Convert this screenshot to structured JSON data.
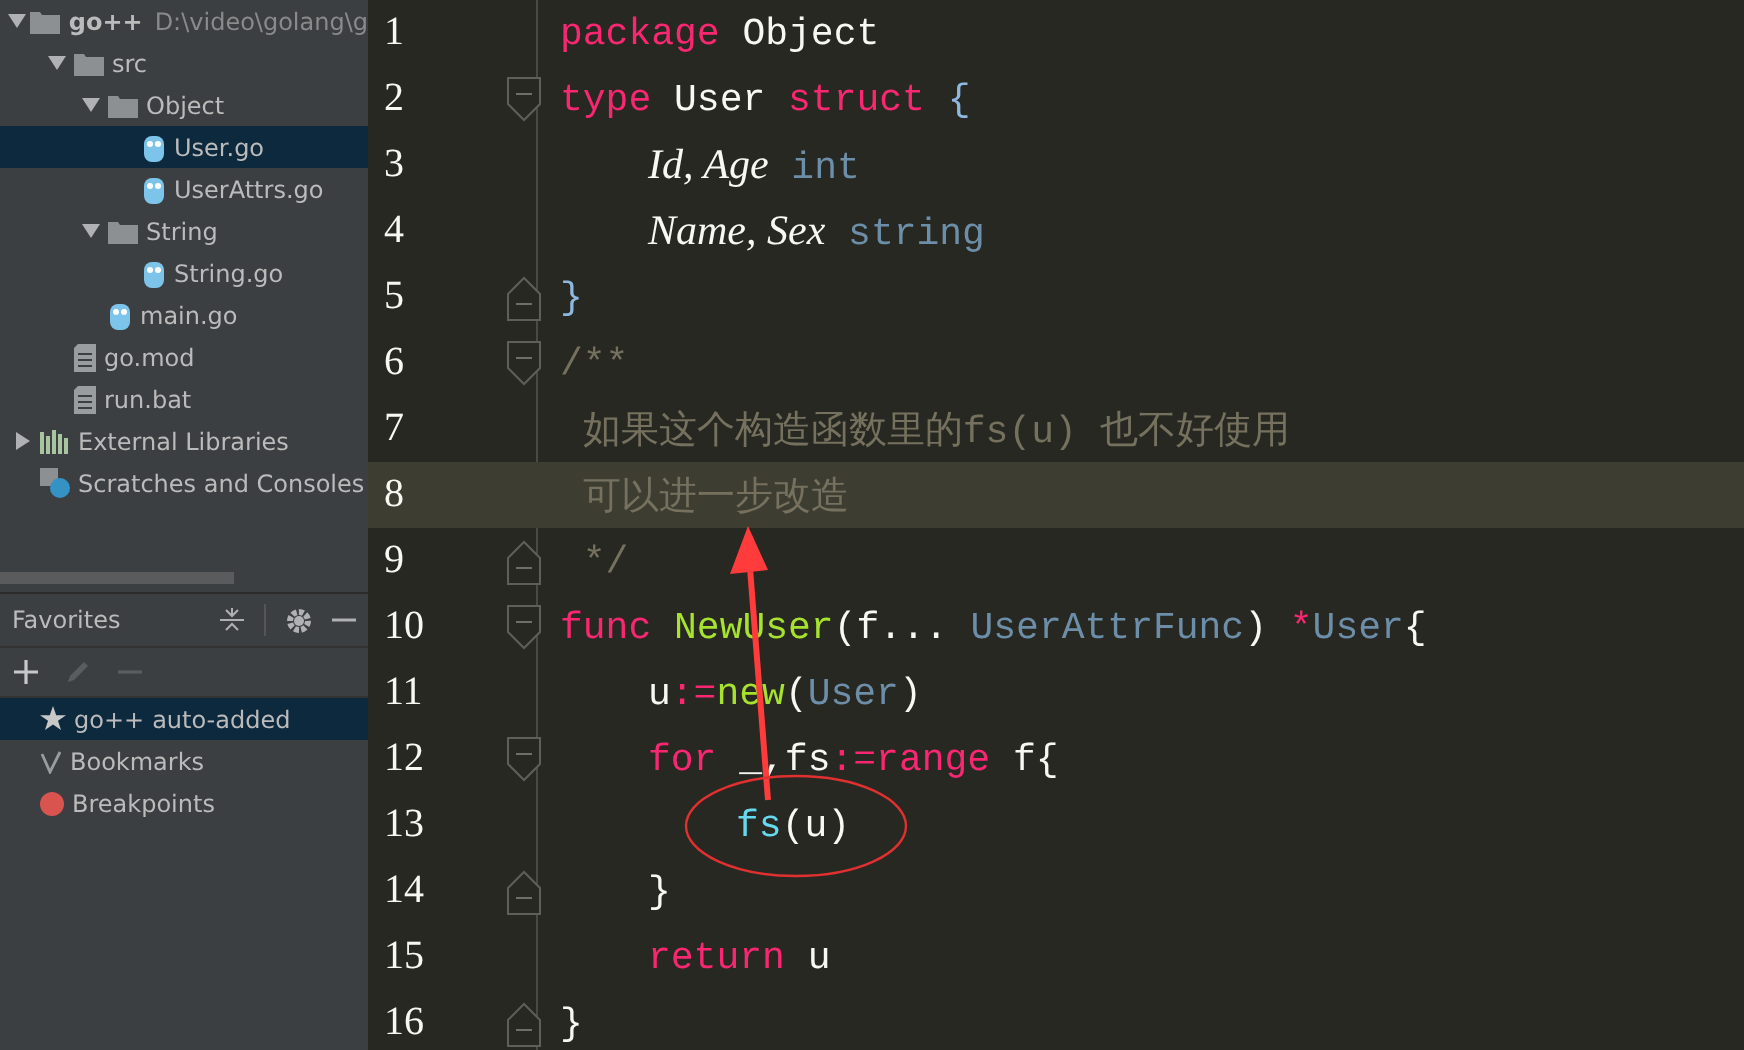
{
  "project_tree": [
    {
      "kind": "folder",
      "name": "go++",
      "path": "D:\\video\\golang\\g",
      "expanded": true,
      "selected": false,
      "children": [
        {
          "kind": "folder",
          "name": "src",
          "expanded": true,
          "selected": false,
          "children": [
            {
              "kind": "folder",
              "name": "Object",
              "expanded": true,
              "selected": false,
              "children": [
                {
                  "kind": "gofile",
                  "name": "User.go",
                  "selected": true
                },
                {
                  "kind": "gofile",
                  "name": "UserAttrs.go",
                  "selected": false
                }
              ]
            },
            {
              "kind": "folder",
              "name": "String",
              "expanded": true,
              "selected": false,
              "children": [
                {
                  "kind": "gofile",
                  "name": "String.go",
                  "selected": false
                }
              ]
            },
            {
              "kind": "gofile",
              "name": "main.go",
              "selected": false
            }
          ]
        },
        {
          "kind": "file",
          "name": "go.mod",
          "selected": false
        },
        {
          "kind": "file",
          "name": "run.bat",
          "selected": false
        }
      ]
    },
    {
      "kind": "library",
      "name": "External Libraries",
      "expanded": false,
      "selected": false
    },
    {
      "kind": "scratches",
      "name": "Scratches and Consoles",
      "selected": false
    }
  ],
  "favorites": {
    "title": "Favorites",
    "toolbar": [
      {
        "kind": "add",
        "disabled": false
      },
      {
        "kind": "edit",
        "disabled": true
      },
      {
        "kind": "remove",
        "disabled": true
      }
    ],
    "items": [
      {
        "kind": "star",
        "label": "go++",
        "note": "auto-added",
        "selected": true
      },
      {
        "kind": "check",
        "label": "Bookmarks",
        "selected": false
      },
      {
        "kind": "dot",
        "label": "Breakpoints",
        "color": "#d9534f",
        "selected": false
      }
    ]
  },
  "editor": {
    "lines": [
      {
        "number": "1",
        "fold_start": false,
        "fold_end": false,
        "current": false,
        "tokens": [
          {
            "kind": "keyword",
            "text": "package"
          },
          {
            "kind": "plain",
            "text": " Object"
          }
        ]
      },
      {
        "number": "2",
        "fold_start": true,
        "fold_end": false,
        "current": false,
        "tokens": [
          {
            "kind": "keyword",
            "text": "type"
          },
          {
            "kind": "plain",
            "text": " User "
          },
          {
            "kind": "keyword",
            "text": "struct"
          },
          {
            "kind": "brace",
            "text": " {"
          }
        ],
        "children": [
          {
            "number": "3",
            "fold_start": false,
            "fold_end": false,
            "current": false,
            "tokens": [
              {
                "kind": "field",
                "text": "Id, Age"
              },
              {
                "kind": "type",
                "text": " int"
              }
            ]
          },
          {
            "number": "4",
            "fold_start": false,
            "fold_end": false,
            "current": false,
            "tokens": [
              {
                "kind": "field",
                "text": "Name, Sex"
              },
              {
                "kind": "type",
                "text": " string"
              }
            ]
          }
        ]
      },
      {
        "number": "5",
        "fold_start": false,
        "fold_end": true,
        "current": false,
        "tokens": [
          {
            "kind": "brace",
            "text": "}"
          }
        ]
      },
      {
        "number": "6",
        "fold_start": true,
        "fold_end": false,
        "current": false,
        "tokens": [
          {
            "kind": "comment",
            "text": "/**"
          }
        ]
      },
      {
        "number": "7",
        "fold_start": false,
        "fold_end": false,
        "current": false,
        "tokens": [
          {
            "kind": "comment",
            "text": " 如果这个构造函数里的fs(u) 也不好使用"
          }
        ]
      },
      {
        "number": "8",
        "fold_start": false,
        "fold_end": false,
        "current": true,
        "tokens": [
          {
            "kind": "comment",
            "text": " 可以进一步改造"
          }
        ]
      },
      {
        "number": "9",
        "fold_start": false,
        "fold_end": true,
        "current": false,
        "tokens": [
          {
            "kind": "comment",
            "text": " */"
          }
        ]
      },
      {
        "number": "10",
        "fold_start": true,
        "fold_end": false,
        "current": false,
        "tokens": [
          {
            "kind": "keyword",
            "text": "func"
          },
          {
            "kind": "func",
            "text": " NewUser"
          },
          {
            "kind": "plain",
            "text": "(f... "
          },
          {
            "kind": "type",
            "text": "UserAttrFunc"
          },
          {
            "kind": "plain",
            "text": ") "
          },
          {
            "kind": "op",
            "text": "*"
          },
          {
            "kind": "type",
            "text": "User"
          },
          {
            "kind": "plain",
            "text": "{"
          }
        ],
        "children": [
          {
            "number": "11",
            "fold_start": false,
            "fold_end": false,
            "current": false,
            "tokens": [
              {
                "kind": "plain",
                "text": "u"
              },
              {
                "kind": "op",
                "text": ":="
              },
              {
                "kind": "func",
                "text": "new"
              },
              {
                "kind": "plain",
                "text": "("
              },
              {
                "kind": "type",
                "text": "User"
              },
              {
                "kind": "plain",
                "text": ")"
              }
            ]
          },
          {
            "number": "12",
            "fold_start": true,
            "fold_end": false,
            "current": false,
            "tokens": [
              {
                "kind": "keyword",
                "text": "for"
              },
              {
                "kind": "plain",
                "text": " _,fs"
              },
              {
                "kind": "op",
                "text": ":="
              },
              {
                "kind": "keyword",
                "text": "range"
              },
              {
                "kind": "plain",
                "text": " f{"
              }
            ],
            "children": [
              {
                "number": "13",
                "fold_start": false,
                "fold_end": false,
                "current": false,
                "tokens": [
                  {
                    "kind": "call",
                    "text": "fs"
                  },
                  {
                    "kind": "plain",
                    "text": "(u)"
                  }
                ]
              }
            ]
          },
          {
            "number": "14",
            "fold_start": false,
            "fold_end": true,
            "current": false,
            "tokens": [
              {
                "kind": "plain",
                "text": "}"
              }
            ]
          },
          {
            "number": "15",
            "fold_start": false,
            "fold_end": false,
            "current": false,
            "tokens": [
              {
                "kind": "keyword",
                "text": "return"
              },
              {
                "kind": "plain",
                "text": " u"
              }
            ]
          }
        ]
      },
      {
        "number": "16",
        "fold_start": false,
        "fold_end": true,
        "current": false,
        "tokens": [
          {
            "kind": "plain",
            "text": "}"
          }
        ]
      }
    ]
  },
  "annotations": [
    {
      "kind": "arrow"
    },
    {
      "kind": "ellipse"
    }
  ]
}
